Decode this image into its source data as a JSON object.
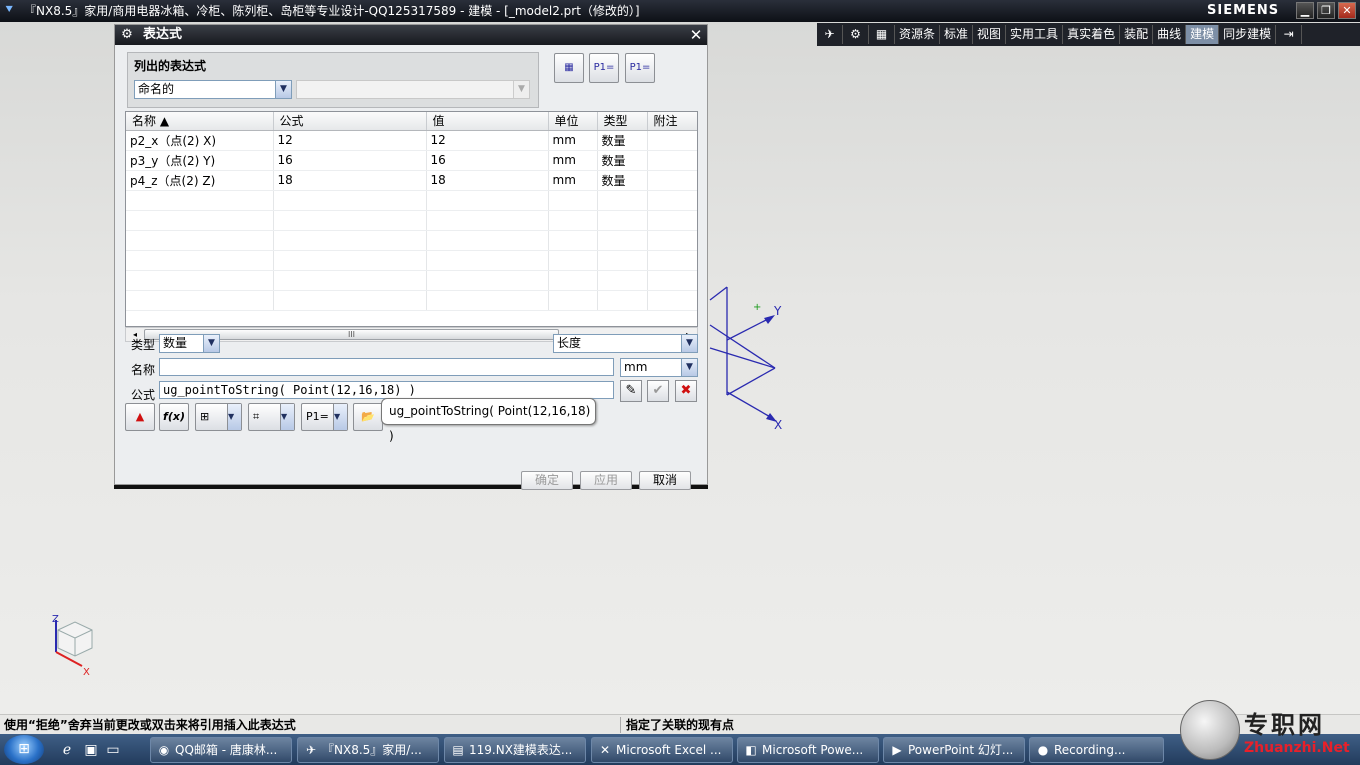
{
  "window": {
    "title": "『NX8.5』家用/商用电器冰箱、冷柜、陈列柜、岛柜等专业设计-QQ125317589 - 建模 - [_model2.prt（修改的）]",
    "brand": "SIEMENS",
    "minimize": "▁",
    "restore": "❐",
    "close": "✕"
  },
  "apptabs": [
    "资源条",
    "标准",
    "视图",
    "实用工具",
    "真实着色",
    "装配",
    "曲线",
    "建模",
    "同步建模"
  ],
  "apptabs_active": "建模",
  "dialog": {
    "title": "表达式",
    "list_group_label": "列出的表达式",
    "list_filter_value": "命名的",
    "list_filter2_value": "",
    "columns": [
      "名称 ▲",
      "公式",
      "值",
      "单位",
      "类型",
      "附注"
    ],
    "rows": [
      [
        "p2_x（点(2) X)",
        "12",
        "12",
        "mm",
        "数量",
        ""
      ],
      [
        "p3_y（点(2) Y)",
        "16",
        "16",
        "mm",
        "数量",
        ""
      ],
      [
        "p4_z（点(2) Z)",
        "18",
        "18",
        "mm",
        "数量",
        ""
      ]
    ],
    "scroll_thumb": "III",
    "type_label": "类型",
    "type_value": "数量",
    "dimension_value": "长度",
    "name_label": "名称",
    "name_value": "",
    "unit_value": "mm",
    "formula_label": "公式",
    "formula_value": "ug_pointToString( Point(12,16,18) )",
    "fx_label": "f(x)",
    "tooltip": "ug_pointToString( Point(12,16,18) )",
    "ok": "确定",
    "apply": "应用",
    "cancel": "取消"
  },
  "csys": {
    "x": "X",
    "y": "Y"
  },
  "triad": {
    "x": "X",
    "z": "Z"
  },
  "status": {
    "left": "使用“拒绝”舍弃当前更改或双击来将引用插入此表达式",
    "right": "指定了关联的现有点"
  },
  "taskbar": {
    "tasks": [
      "QQ邮箱 - 唐康林...",
      "『NX8.5』家用/...",
      "119.NX建模表达...",
      "Microsoft Excel ...",
      "Microsoft Powe...",
      "PowerPoint 幻灯...",
      "Recording..."
    ]
  },
  "watermark": {
    "text": "专职网",
    "url": "Zhuanzhi.Net"
  }
}
